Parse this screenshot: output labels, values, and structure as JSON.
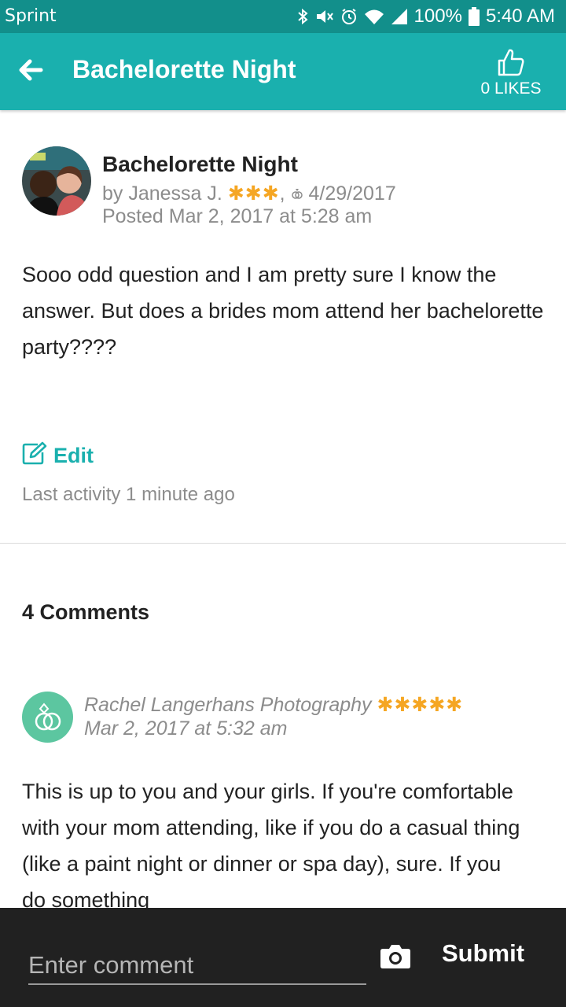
{
  "status_bar": {
    "carrier": "Sprint",
    "battery": "100%",
    "time": "5:40 AM"
  },
  "app_bar": {
    "title": "Bachelorette Night",
    "likes": "0 LIKES"
  },
  "post": {
    "title": "Bachelorette Night",
    "author_prefix": "by Janessa J.",
    "author_stars": "✱✱✱",
    "wedding_date_sep": ",",
    "wedding_date": "4/29/2017",
    "posted": "Posted Mar 2, 2017 at 5:28 am",
    "body": "Sooo odd question and I am pretty sure I know the answer. But does a brides mom attend her bachelorette party????",
    "edit_label": "Edit",
    "last_activity": "Last activity 1 minute ago"
  },
  "comments": {
    "heading": "4 Comments",
    "items": [
      {
        "author": "Rachel Langerhans Photography",
        "stars": "✱✱✱✱✱",
        "date": "Mar 2, 2017 at 5:32 am",
        "body": "This is up to you and your girls. If you're comfortable with your mom attending, like if you do a casual thing (like a paint night or dinner or spa day), sure. If you do something"
      }
    ]
  },
  "composer": {
    "placeholder": "Enter comment",
    "submit_label": "Submit"
  },
  "colors": {
    "status_bar": "#128f8b",
    "app_bar": "#1ab0ae",
    "accent": "#1ab0ae",
    "stars": "#f5a623",
    "composer_bg": "#212121"
  },
  "icons": [
    "back-arrow-icon",
    "thumbs-up-icon",
    "bluetooth-icon",
    "mute-icon",
    "alarm-icon",
    "wifi-icon",
    "signal-icon",
    "battery-icon",
    "edit-icon",
    "rings-icon",
    "camera-icon"
  ]
}
